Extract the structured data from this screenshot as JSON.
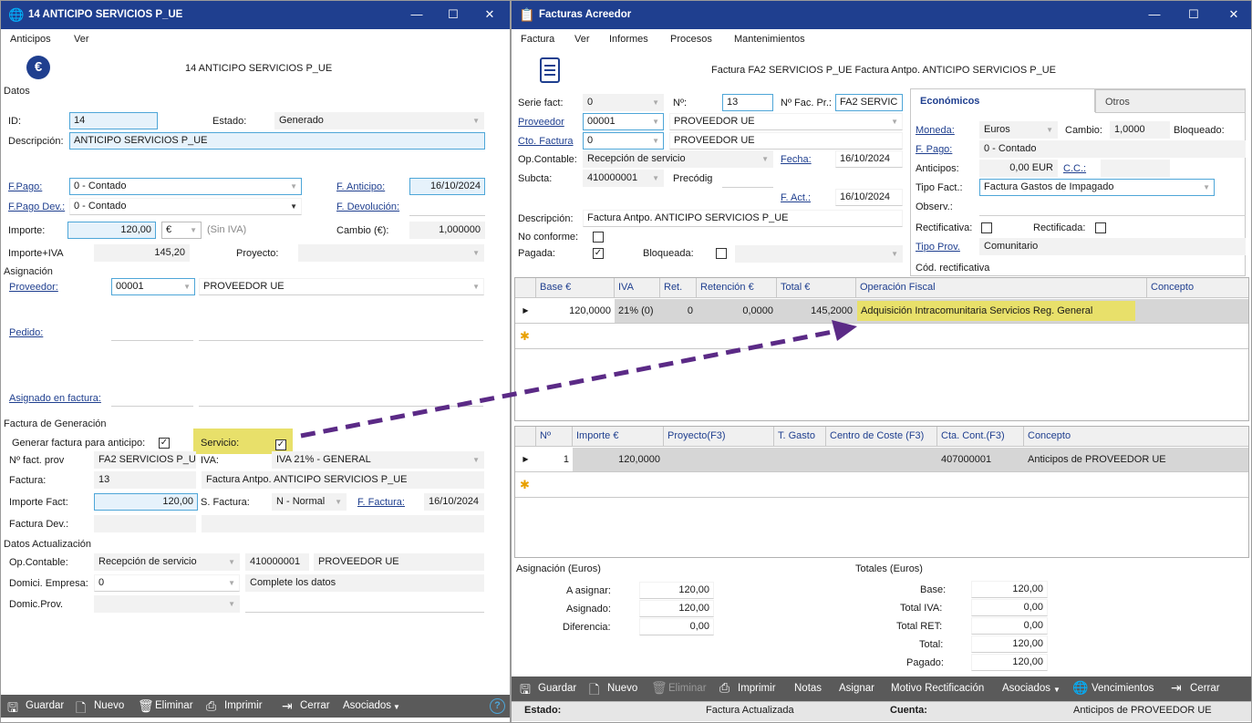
{
  "left": {
    "title": "14 ANTICIPO SERVICIOS P_UE",
    "menu": [
      "Anticipos",
      "Ver"
    ],
    "header_text": "14 ANTICIPO SERVICIOS P_UE",
    "sections": {
      "datos": "Datos",
      "asignacion": "Asignación",
      "factura_generacion": "Factura de Generación",
      "datos_actualizacion": "Datos Actualización"
    },
    "labels": {
      "id": "ID:",
      "estado": "Estado:",
      "descripcion": "Descripción:",
      "fpago": "F.Pago:",
      "fanticipo": "F. Anticipo:",
      "fpago_dev": "F.Pago Dev.:",
      "fdevolucion": "F. Devolución:",
      "importe": "Importe:",
      "sin_iva": "(Sin IVA)",
      "cambio": "Cambio (€):",
      "importe_iva": "Importe+IVA",
      "proyecto": "Proyecto:",
      "proveedor": "Proveedor:",
      "pedido": "Pedido:",
      "asignado": "Asignado en factura:",
      "generar": "Generar factura para anticipo:",
      "servicio": "Servicio:",
      "nfact_prov": "Nº fact. prov",
      "iva": "IVA:",
      "factura": "Factura:",
      "importe_fact": "Importe Fact:",
      "sfactura": "S. Factura:",
      "ffactura": "F. Factura:",
      "factura_dev": "Factura Dev.:",
      "op_contable": "Op.Contable:",
      "domici_empresa": "Domici. Empresa:",
      "domic_prov": "Domic.Prov."
    },
    "values": {
      "id": "14",
      "estado": "Generado",
      "descripcion": "ANTICIPO SERVICIOS P_UE",
      "fpago": "0 - Contado",
      "fanticipo": "16/10/2024",
      "fpago_dev": "0 - Contado",
      "importe": "120,00",
      "moneda": "€",
      "cambio": "1,000000",
      "importe_iva": "145,20",
      "proveedor_code": "00001",
      "proveedor_name": "PROVEEDOR UE",
      "generar_checked": "✓",
      "servicio_checked": "✓",
      "nfact_prov": "FA2 SERVICIOS P_U",
      "iva": "IVA 21% - GENERAL",
      "factura_num": "13",
      "factura_desc": "Factura Antpo. ANTICIPO SERVICIOS P_UE",
      "importe_fact": "120,00",
      "sfactura": "N - Normal",
      "ffactura": "16/10/2024",
      "op_contable": "Recepción de servicio",
      "op_cuenta": "410000001",
      "op_nombre": "PROVEEDOR UE",
      "domici_empresa": "0",
      "domici_msg": "Complete los datos"
    },
    "toolbar": [
      "Guardar",
      "Nuevo",
      "Eliminar",
      "Imprimir",
      "Cerrar",
      "Asociados"
    ]
  },
  "right": {
    "title": "Facturas Acreedor",
    "menu": [
      "Factura",
      "Ver",
      "Informes",
      "Procesos",
      "Mantenimientos"
    ],
    "header_text": "Factura FA2 SERVICIOS P_UE Factura Antpo. ANTICIPO SERVICIOS P_UE",
    "labels": {
      "serie": "Serie fact:",
      "num": "Nº:",
      "nfac_pr": "Nº Fac. Pr.:",
      "proveedor": "Proveedor",
      "cto_factura": "Cto. Factura",
      "op_contable": "Op.Contable:",
      "fecha": "Fecha:",
      "subcta": "Subcta:",
      "precodig": "Precódig",
      "fact": "F. Act.:",
      "descripcion": "Descripción:",
      "no_conforme": "No conforme:",
      "pagada": "Pagada:",
      "bloqueada": "Bloqueada:"
    },
    "values": {
      "serie": "0",
      "num": "13",
      "nfac_pr": "FA2 SERVIC",
      "proveedor_code": "00001",
      "proveedor_name": "PROVEEDOR UE",
      "cto_code": "0",
      "cto_name": "PROVEEDOR UE",
      "op_contable": "Recepción de servicio",
      "fecha": "16/10/2024",
      "subcta": "410000001",
      "fact": "16/10/2024",
      "descripcion": "Factura Antpo. ANTICIPO SERVICIOS P_UE",
      "pagada_checked": "✓"
    },
    "tabs": [
      "Económicos",
      "Otros"
    ],
    "eco_labels": {
      "moneda": "Moneda:",
      "cambio": "Cambio:",
      "bloqueado": "Bloqueado:",
      "fpago": "F. Pago:",
      "anticipos": "Anticipos:",
      "cc": "C.C.:",
      "tipo_fact": "Tipo Fact.:",
      "observ": "Observ.:",
      "rectificativa": "Rectificativa:",
      "rectificada": "Rectificada:",
      "tipo_prov": "Tipo Prov.",
      "cod_rect": "Cód. rectificativa"
    },
    "eco_values": {
      "moneda": "Euros",
      "cambio": "1,0000",
      "fpago": "0 - Contado",
      "anticipos": "0,00 EUR",
      "tipo_fact": "Factura Gastos de Impagado",
      "tipo_prov": "Comunitario"
    },
    "grid1": {
      "headers": [
        "Base €",
        "IVA",
        "Ret.",
        "Retención €",
        "Total €",
        "Operación Fiscal",
        "Concepto"
      ],
      "row": [
        "120,0000",
        "21% (0)",
        "0",
        "0,0000",
        "145,2000",
        "Adquisición Intracomunitaria Servicios Reg. General",
        ""
      ]
    },
    "grid2": {
      "headers": [
        "Nº",
        "Importe €",
        "Proyecto(F3)",
        "T. Gasto",
        "Centro de Coste (F3)",
        "Cta. Cont.(F3)",
        "Concepto"
      ],
      "row": [
        "1",
        "120,0000",
        "",
        "",
        "",
        "407000001",
        "Anticipos de PROVEEDOR UE"
      ]
    },
    "asignacion": {
      "title": "Asignación (Euros)",
      "a_asignar_label": "A asignar:",
      "a_asignar": "120,00",
      "asignado_label": "Asignado:",
      "asignado": "120,00",
      "diferencia_label": "Diferencia:",
      "diferencia": "0,00"
    },
    "totales": {
      "title": "Totales (Euros)",
      "base_label": "Base:",
      "base": "120,00",
      "total_iva_label": "Total IVA:",
      "total_iva": "0,00",
      "total_ret_label": "Total RET:",
      "total_ret": "0,00",
      "total_label": "Total:",
      "total": "120,00",
      "pagado_label": "Pagado:",
      "pagado": "120,00"
    },
    "toolbar": [
      "Guardar",
      "Nuevo",
      "Eliminar",
      "Imprimir",
      "Notas",
      "Asignar",
      "Motivo Rectificación",
      "Asociados",
      "Vencimientos",
      "Cerrar"
    ],
    "status": {
      "estado_label": "Estado:",
      "estado": "Factura Actualizada",
      "cuenta_label": "Cuenta:",
      "cuenta": "Anticipos de PROVEEDOR UE"
    }
  },
  "colors": {
    "titlebar": "#1f3f8f",
    "highlight": "#e8e06a",
    "arrow": "#5b2a86",
    "toolbar": "#5a5a5a"
  }
}
